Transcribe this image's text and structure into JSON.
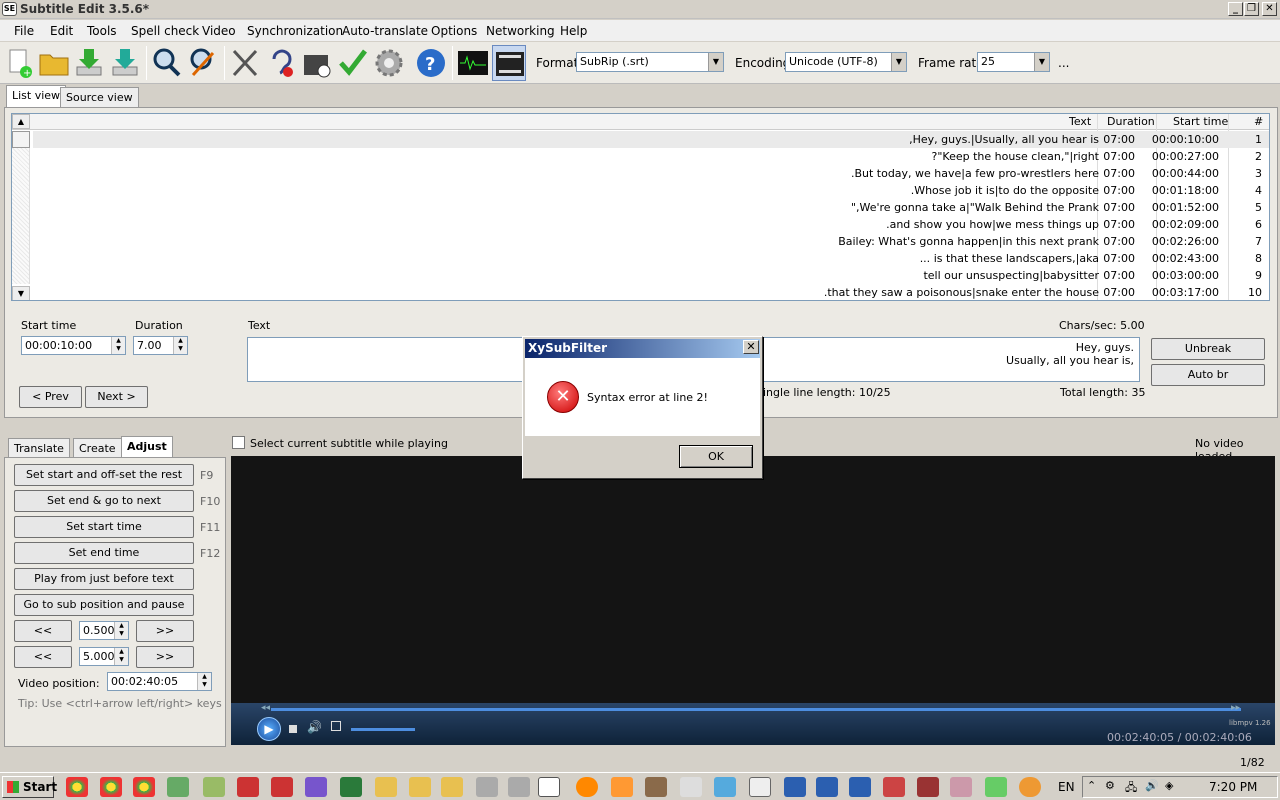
{
  "window": {
    "title": "Subtitle Edit 3.5.6*",
    "app_icon": "SE"
  },
  "menu": [
    "File",
    "Edit",
    "Tools",
    "Spell check",
    "Video",
    "Synchronization",
    "Auto-translate",
    "Options",
    "Networking",
    "Help"
  ],
  "toolbar": {
    "icons": [
      "new-file-icon",
      "open-folder-icon",
      "download-icon",
      "download-alt-icon",
      "find-icon",
      "replace-icon",
      "fix-errors-icon",
      "remove-hearing-impaired-icon",
      "visual-sync-icon",
      "spell-check-icon",
      "settings-icon",
      "help-icon",
      "waveform-icon",
      "video-icon"
    ],
    "format_label": "Format",
    "format_value": "SubRip (.srt)",
    "encoding_label": "Encoding",
    "encoding_value": "Unicode (UTF-8)",
    "framerate_label": "Frame rate",
    "framerate_value": "25",
    "more": "..."
  },
  "view_tabs": [
    "List view",
    "Source view"
  ],
  "grid": {
    "columns": {
      "text": "Text",
      "duration": "Duration",
      "start": "Start time",
      "num": "#"
    },
    "rows": [
      {
        "text": "Hey, guys.|Usually, all you hear is,",
        "duration": "07:00",
        "start": "00:00:10:00",
        "num": "1"
      },
      {
        "text": "Keep the house clean,\"|right\"?",
        "duration": "07:00",
        "start": "00:00:27:00",
        "num": "2"
      },
      {
        "text": "But today, we have|a few pro-wrestlers here.",
        "duration": "07:00",
        "start": "00:00:44:00",
        "num": "3"
      },
      {
        "text": "Whose job it is|to do the opposite.",
        "duration": "07:00",
        "start": "00:01:18:00",
        "num": "4"
      },
      {
        "text": "We're gonna take a|\"Walk Behind the Prank,\"",
        "duration": "07:00",
        "start": "00:01:52:00",
        "num": "5"
      },
      {
        "text": "and show you how|we mess things up.",
        "duration": "07:00",
        "start": "00:02:09:00",
        "num": "6"
      },
      {
        "text": "Bailey: What's gonna happen|in this next prank",
        "duration": "07:00",
        "start": "00:02:26:00",
        "num": "7"
      },
      {
        "text": "is that these landscapers,|aka ...",
        "duration": "07:00",
        "start": "00:02:43:00",
        "num": "8"
      },
      {
        "text": "tell our unsuspecting|babysitter",
        "duration": "07:00",
        "start": "00:03:00:00",
        "num": "9"
      },
      {
        "text": "that they saw a poisonous|snake enter the house.",
        "duration": "07:00",
        "start": "00:03:17:00",
        "num": "10"
      }
    ]
  },
  "editor": {
    "start_label": "Start time",
    "start_value": "00:00:10:00",
    "duration_label": "Duration",
    "duration_value": "7.00",
    "text_label": "Text",
    "chars_sec": "Chars/sec: 5.00",
    "text_line1": "Hey, guys.",
    "text_line2": "Usually, all you hear is,",
    "prev": "< Prev",
    "next": "Next >",
    "single_line": "ingle line length: 10/25",
    "total_length": "Total length: 35",
    "unbreak": "Unbreak",
    "autobr": "Auto br"
  },
  "bottom_tabs": [
    "Translate",
    "Create",
    "Adjust"
  ],
  "adjust": {
    "buttons": [
      {
        "label": "Set start and off-set the rest",
        "key": "F9"
      },
      {
        "label": "Set end & go to next",
        "key": "F10"
      },
      {
        "label": "Set start time",
        "key": "F11"
      },
      {
        "label": "Set end time",
        "key": "F12"
      },
      {
        "label": "Play from just before text",
        "key": ""
      },
      {
        "label": "Go to sub position and pause",
        "key": ""
      }
    ],
    "back": "<<",
    "fwd": ">>",
    "step1": "0.500",
    "step2": "5.000",
    "video_pos_label": "Video position:",
    "video_pos_value": "00:02:40:05",
    "tip": "Tip: Use <ctrl+arrow left/right> keys"
  },
  "video": {
    "select_current": "Select current subtitle while playing",
    "no_video": "No video loaded",
    "time": "00:02:40:05 / 00:02:40:06",
    "libmpv": "libmpv 1.26"
  },
  "status": "1/82",
  "dialog": {
    "title": "XySubFilter",
    "message": "Syntax error at line 2!",
    "ok": "OK"
  },
  "taskbar": {
    "start": "Start",
    "lang": "EN",
    "time": "7:20 PM"
  }
}
